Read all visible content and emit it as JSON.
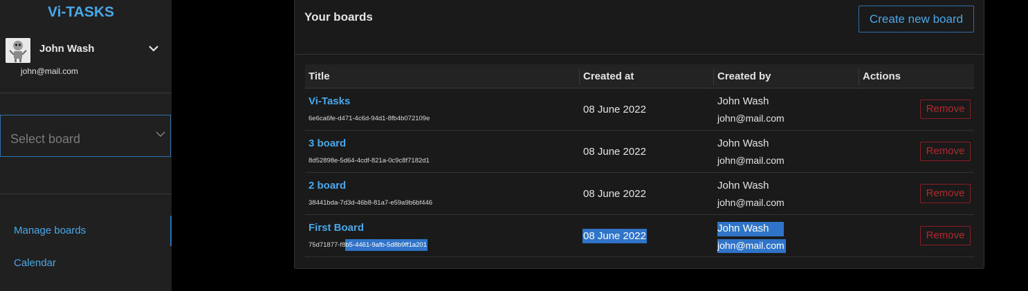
{
  "sidebar": {
    "brand": "Vi-TASKS",
    "user": {
      "name": "John Wash",
      "email": "john@mail.com"
    },
    "board_select": {
      "placeholder": "Select board"
    },
    "nav": [
      {
        "label": "Manage boards",
        "active": true
      },
      {
        "label": "Calendar",
        "active": false
      }
    ]
  },
  "main": {
    "title": "Your boards",
    "create_button": "Create new board",
    "columns": [
      "Title",
      "Created at",
      "Created by",
      "Actions"
    ],
    "rows": [
      {
        "title": "Vi-Tasks",
        "id": "6e6ca6fe-d471-4c6d-94d1-8fb4b072109e",
        "created_at": "08 June 2022",
        "created_by_name": "John Wash",
        "created_by_email": "john@mail.com",
        "action": "Remove"
      },
      {
        "title": "3 board",
        "id": "8d52898e-5d64-4cdf-821a-0c9c8f7182d1",
        "created_at": "08 June 2022",
        "created_by_name": "John Wash",
        "created_by_email": "john@mail.com",
        "action": "Remove"
      },
      {
        "title": "2 board",
        "id": "38441bda-7d3d-46b8-81a7-e59a9b6bf446",
        "created_at": "08 June 2022",
        "created_by_name": "John Wash",
        "created_by_email": "john@mail.com",
        "action": "Remove"
      },
      {
        "title": "First Board",
        "id_prefix": "75d71877-f8",
        "id_selected": "b5-4461-9afb-5d8b9ff1a201",
        "created_at": "08 June 2022",
        "created_by_name": "John Wash",
        "created_by_email": "john@mail.com",
        "action": "Remove"
      }
    ]
  },
  "colors": {
    "accent": "#4aa8e8",
    "border_accent": "#2e6fb0",
    "danger": "#b02a2f",
    "selection": "#2f74c9"
  }
}
